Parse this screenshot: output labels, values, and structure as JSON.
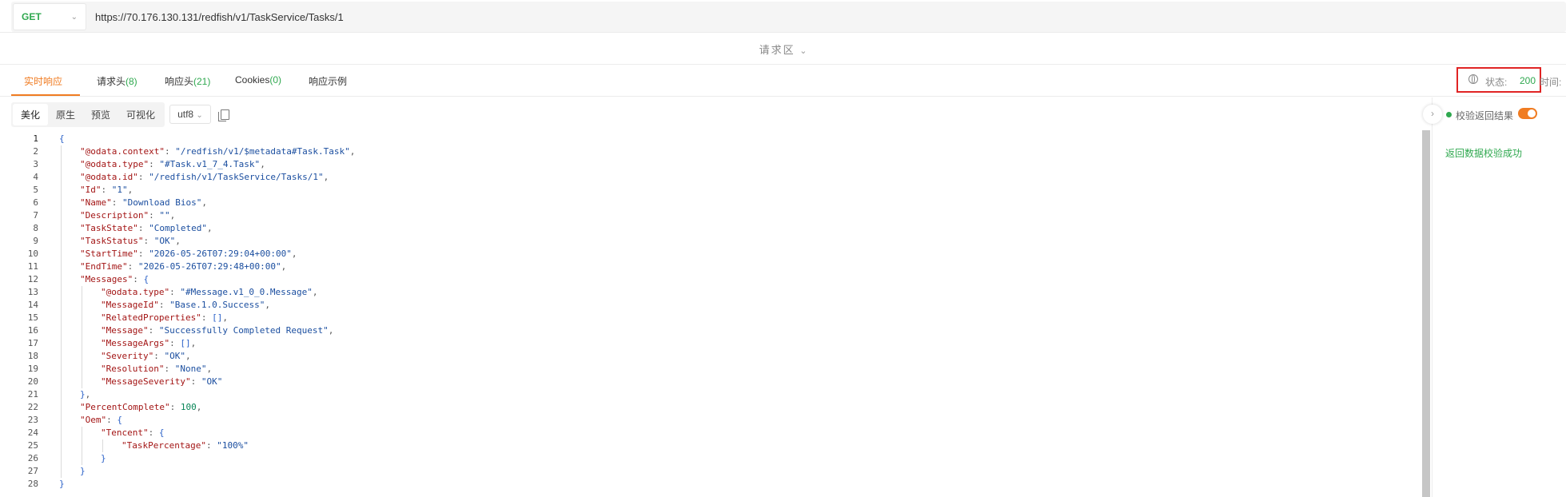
{
  "request": {
    "method": "GET",
    "url": "https://70.176.130.131/redfish/v1/TaskService/Tasks/1",
    "area_label": "请求区"
  },
  "tabs": [
    {
      "label": "实时响应",
      "count": "",
      "active": true
    },
    {
      "label": "请求头",
      "count": "(8)",
      "active": false
    },
    {
      "label": "响应头",
      "count": "(21)",
      "active": false
    },
    {
      "label": "Cookies",
      "count": "(0)",
      "active": false
    },
    {
      "label": "响应示例",
      "count": "",
      "active": false
    }
  ],
  "status": {
    "label": "状态:",
    "value": "200",
    "time_label": "时间:"
  },
  "toolbar": {
    "views": [
      "美化",
      "原生",
      "预览",
      "可视化"
    ],
    "active_view": "美化",
    "encoding": "utf8"
  },
  "right_panel": {
    "validate_label": "校验返回结果",
    "validate_enabled": true,
    "validate_result": "返回数据校验成功"
  },
  "colors": {
    "accent": "#f07c22",
    "success": "#2fa84f",
    "highlight": "#e02424"
  },
  "code_lines": [
    {
      "n": "1",
      "indent": 0,
      "parts": [
        [
          "b",
          "{"
        ]
      ]
    },
    {
      "n": "2",
      "indent": 1,
      "parts": [
        [
          "k",
          "\"@odata.context\""
        ],
        [
          "p",
          ": "
        ],
        [
          "s",
          "\"/redfish/v1/$metadata#Task.Task\""
        ],
        [
          "p",
          ","
        ]
      ]
    },
    {
      "n": "3",
      "indent": 1,
      "parts": [
        [
          "k",
          "\"@odata.type\""
        ],
        [
          "p",
          ": "
        ],
        [
          "s",
          "\"#Task.v1_7_4.Task\""
        ],
        [
          "p",
          ","
        ]
      ]
    },
    {
      "n": "4",
      "indent": 1,
      "parts": [
        [
          "k",
          "\"@odata.id\""
        ],
        [
          "p",
          ": "
        ],
        [
          "s",
          "\"/redfish/v1/TaskService/Tasks/1\""
        ],
        [
          "p",
          ","
        ]
      ]
    },
    {
      "n": "5",
      "indent": 1,
      "parts": [
        [
          "k",
          "\"Id\""
        ],
        [
          "p",
          ": "
        ],
        [
          "s",
          "\"1\""
        ],
        [
          "p",
          ","
        ]
      ]
    },
    {
      "n": "6",
      "indent": 1,
      "parts": [
        [
          "k",
          "\"Name\""
        ],
        [
          "p",
          ": "
        ],
        [
          "s",
          "\"Download Bios\""
        ],
        [
          "p",
          ","
        ]
      ]
    },
    {
      "n": "7",
      "indent": 1,
      "parts": [
        [
          "k",
          "\"Description\""
        ],
        [
          "p",
          ": "
        ],
        [
          "s",
          "\"\""
        ],
        [
          "p",
          ","
        ]
      ]
    },
    {
      "n": "8",
      "indent": 1,
      "parts": [
        [
          "k",
          "\"TaskState\""
        ],
        [
          "p",
          ": "
        ],
        [
          "s",
          "\"Completed\""
        ],
        [
          "p",
          ","
        ]
      ]
    },
    {
      "n": "9",
      "indent": 1,
      "parts": [
        [
          "k",
          "\"TaskStatus\""
        ],
        [
          "p",
          ": "
        ],
        [
          "s",
          "\"OK\""
        ],
        [
          "p",
          ","
        ]
      ]
    },
    {
      "n": "10",
      "indent": 1,
      "parts": [
        [
          "k",
          "\"StartTime\""
        ],
        [
          "p",
          ": "
        ],
        [
          "s",
          "\"2026-05-26T07:29:04+00:00\""
        ],
        [
          "p",
          ","
        ]
      ]
    },
    {
      "n": "11",
      "indent": 1,
      "parts": [
        [
          "k",
          "\"EndTime\""
        ],
        [
          "p",
          ": "
        ],
        [
          "s",
          "\"2026-05-26T07:29:48+00:00\""
        ],
        [
          "p",
          ","
        ]
      ]
    },
    {
      "n": "12",
      "indent": 1,
      "parts": [
        [
          "k",
          "\"Messages\""
        ],
        [
          "p",
          ": "
        ],
        [
          "b",
          "{"
        ]
      ]
    },
    {
      "n": "13",
      "indent": 2,
      "parts": [
        [
          "k",
          "\"@odata.type\""
        ],
        [
          "p",
          ": "
        ],
        [
          "s",
          "\"#Message.v1_0_0.Message\""
        ],
        [
          "p",
          ","
        ]
      ]
    },
    {
      "n": "14",
      "indent": 2,
      "parts": [
        [
          "k",
          "\"MessageId\""
        ],
        [
          "p",
          ": "
        ],
        [
          "s",
          "\"Base.1.0.Success\""
        ],
        [
          "p",
          ","
        ]
      ]
    },
    {
      "n": "15",
      "indent": 2,
      "parts": [
        [
          "k",
          "\"RelatedProperties\""
        ],
        [
          "p",
          ": "
        ],
        [
          "b",
          "[]"
        ],
        [
          "p",
          ","
        ]
      ]
    },
    {
      "n": "16",
      "indent": 2,
      "parts": [
        [
          "k",
          "\"Message\""
        ],
        [
          "p",
          ": "
        ],
        [
          "s",
          "\"Successfully Completed Request\""
        ],
        [
          "p",
          ","
        ]
      ]
    },
    {
      "n": "17",
      "indent": 2,
      "parts": [
        [
          "k",
          "\"MessageArgs\""
        ],
        [
          "p",
          ": "
        ],
        [
          "b",
          "[]"
        ],
        [
          "p",
          ","
        ]
      ]
    },
    {
      "n": "18",
      "indent": 2,
      "parts": [
        [
          "k",
          "\"Severity\""
        ],
        [
          "p",
          ": "
        ],
        [
          "s",
          "\"OK\""
        ],
        [
          "p",
          ","
        ]
      ]
    },
    {
      "n": "19",
      "indent": 2,
      "parts": [
        [
          "k",
          "\"Resolution\""
        ],
        [
          "p",
          ": "
        ],
        [
          "s",
          "\"None\""
        ],
        [
          "p",
          ","
        ]
      ]
    },
    {
      "n": "20",
      "indent": 2,
      "parts": [
        [
          "k",
          "\"MessageSeverity\""
        ],
        [
          "p",
          ": "
        ],
        [
          "s",
          "\"OK\""
        ]
      ]
    },
    {
      "n": "21",
      "indent": 1,
      "parts": [
        [
          "b",
          "}"
        ],
        [
          "p",
          ","
        ]
      ]
    },
    {
      "n": "22",
      "indent": 1,
      "parts": [
        [
          "k",
          "\"PercentComplete\""
        ],
        [
          "p",
          ": "
        ],
        [
          "n",
          "100"
        ],
        [
          "p",
          ","
        ]
      ]
    },
    {
      "n": "23",
      "indent": 1,
      "parts": [
        [
          "k",
          "\"Oem\""
        ],
        [
          "p",
          ": "
        ],
        [
          "b",
          "{"
        ]
      ]
    },
    {
      "n": "24",
      "indent": 2,
      "parts": [
        [
          "k",
          "\"Tencent\""
        ],
        [
          "p",
          ": "
        ],
        [
          "b",
          "{"
        ]
      ]
    },
    {
      "n": "25",
      "indent": 3,
      "parts": [
        [
          "k",
          "\"TaskPercentage\""
        ],
        [
          "p",
          ": "
        ],
        [
          "s",
          "\"100%\""
        ]
      ]
    },
    {
      "n": "26",
      "indent": 2,
      "parts": [
        [
          "b",
          "}"
        ]
      ]
    },
    {
      "n": "27",
      "indent": 1,
      "parts": [
        [
          "b",
          "}"
        ]
      ]
    },
    {
      "n": "28",
      "indent": 0,
      "parts": [
        [
          "b",
          "}"
        ]
      ]
    }
  ]
}
